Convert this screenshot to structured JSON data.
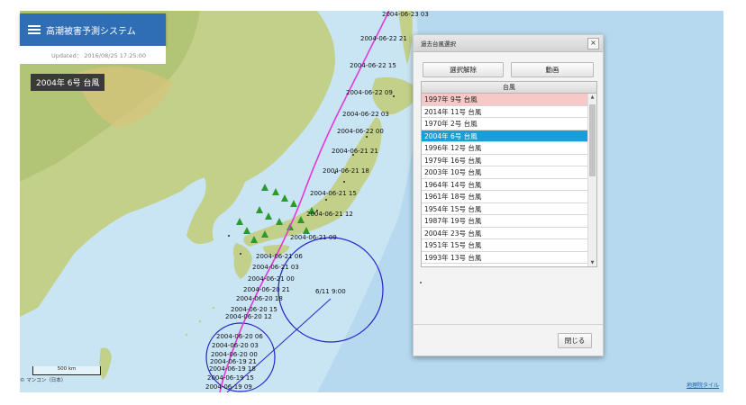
{
  "header": {
    "title": "高潮被害予測システム",
    "menu_icon": "hamburger-menu-icon"
  },
  "updated": "Updated： 2016/08/25 17:25:00",
  "storm_label": "2004年 6号 台風",
  "map": {
    "track_labels": [
      "2004-06-23 03",
      "2004-06-22 21",
      "2004-06-22 15",
      "2004-06-22 09",
      "2004-06-22 03",
      "2004-06-22 00",
      "2004-06-21 21",
      "2004-06-21 18",
      "2004-06-21 15",
      "2004-06-21 12",
      "2004-06-21 09",
      "2004-06-21 06",
      "2004-06-21 03",
      "2004-06-21 00",
      "2004-06-20 21",
      "2004-06-20 18",
      "2004-06-20 15",
      "2004-06-20 12",
      "2004-06-20 06",
      "2004-06-20 03",
      "2004-06-20 00",
      "2004-06-19 21",
      "2004-06-19 18",
      "2004-06-19 15",
      "2004-06-19 09"
    ],
    "circle_label": "6/11 9:00",
    "colors": {
      "track": "#e436d9",
      "circle": "#2424c8",
      "land": "#c2d08a",
      "sea": "#c9e4f3",
      "marker": "#2a9a2a"
    }
  },
  "dialog": {
    "title": "過去台風選択",
    "close_icon": "close-icon",
    "buttons": {
      "deselect": "選択解除",
      "animate": "動画"
    },
    "list_header": "台風",
    "items": [
      "1997年 9号 台風",
      "2014年 11号 台風",
      "1970年 2号 台風",
      "2004年 6号 台風",
      "1996年 12号 台風",
      "1979年 16号 台風",
      "2003年 10号 台風",
      "1964年 14号 台風",
      "1961年 18号 台風",
      "1954年 15号 台風",
      "1987年 19号 台風",
      "2004年 23号 台風",
      "1951年 15号 台風",
      "1993年 13号 台風"
    ],
    "highlighted_item": "1997年 9号 台風",
    "selected_item": "2004年 6号 台風",
    "close_button": "閉じる",
    "colors": {
      "highlight": "#f6c8c8",
      "selected": "#1a9ed6"
    }
  },
  "scale_label": "500 km",
  "attribution": "© マンコン（日本）",
  "source_link": "地理院タイル"
}
